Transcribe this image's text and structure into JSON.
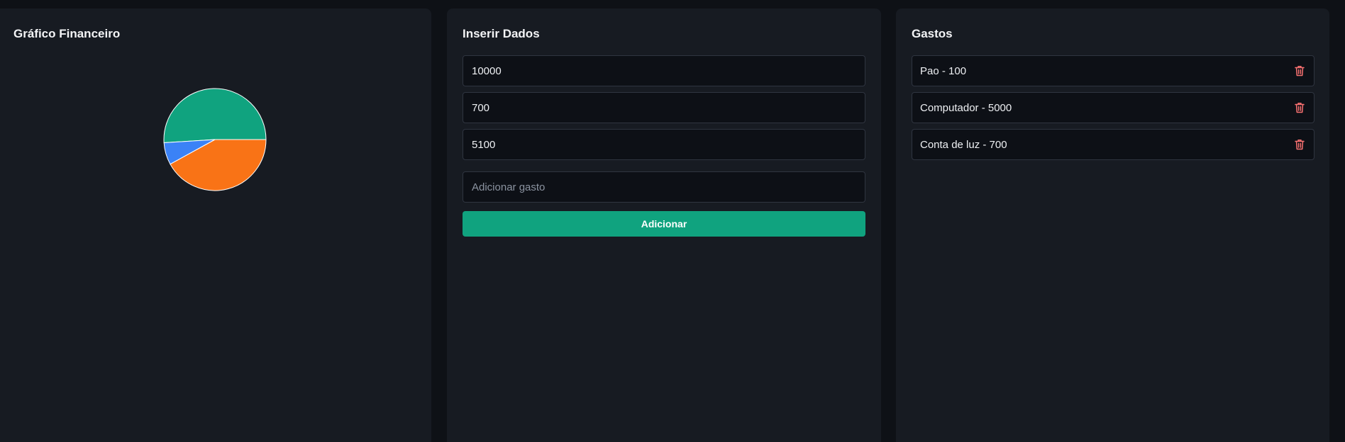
{
  "chart_panel": {
    "title": "Gráfico Financeiro"
  },
  "chart_data": {
    "type": "pie",
    "title": "",
    "values": [
      5100,
      4200,
      700
    ],
    "colors": [
      "#10a37f",
      "#f97316",
      "#3b82f6"
    ],
    "legend": "none"
  },
  "form_panel": {
    "title": "Inserir Dados",
    "fields": [
      {
        "value": "10000"
      },
      {
        "value": "700"
      },
      {
        "value": "5100"
      }
    ],
    "expense_input": {
      "value": "",
      "placeholder": "Adicionar gasto"
    },
    "add_button_label": "Adicionar"
  },
  "expenses_panel": {
    "title": "Gastos",
    "items": [
      {
        "label": "Pao - 100",
        "icon": "trash-icon"
      },
      {
        "label": "Computador - 5000",
        "icon": "trash-icon"
      },
      {
        "label": "Conta de luz - 700",
        "icon": "trash-icon"
      }
    ]
  },
  "colors": {
    "accent": "#10a37f",
    "delete": "#f87171",
    "panel_bg": "#171b22",
    "page_bg": "#0e1116"
  }
}
